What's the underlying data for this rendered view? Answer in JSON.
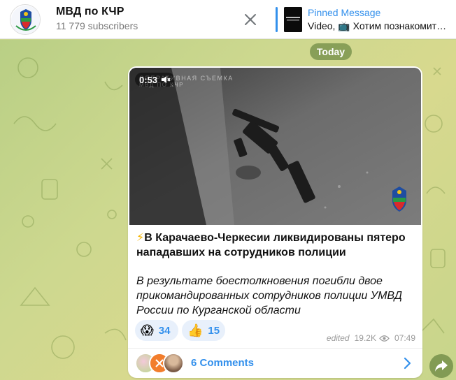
{
  "header": {
    "channel_name": "МВД по КЧР",
    "subscribers": "11 779 subscribers",
    "avatar_icon": "police-emblem-icon",
    "close_icon": "close-icon",
    "pinned": {
      "title": "Pinned Message",
      "text": "Video, 📺 Хотим познакомит…"
    }
  },
  "chat": {
    "date_label": "Today",
    "message": {
      "video": {
        "duration": "0:53",
        "muted_icon": "speaker-muted-icon",
        "watermark_line1": "ОПЕРАТИВНАЯ СЪЕМКА",
        "watermark_line2": "МВД ПО КЧР"
      },
      "title_emoji": "⚡",
      "title": "В Карачаево-Черкесии ликвидированы пятеро нападавших на сотрудников полиции",
      "body": "В результате боестолкновения погибли двое прикомандированных сотрудников полиции УМВД России по Курганской области",
      "reactions": [
        {
          "emoji": "😱",
          "count": "34"
        },
        {
          "emoji": "👍",
          "count": "15"
        }
      ],
      "edited_label": "edited",
      "views": "19.2K",
      "time": "07:49",
      "comments_label": "6 Comments"
    }
  },
  "colors": {
    "accent": "#3390ec",
    "date_pill": "#708c46",
    "reaction_bg": "#e8f0fb"
  }
}
